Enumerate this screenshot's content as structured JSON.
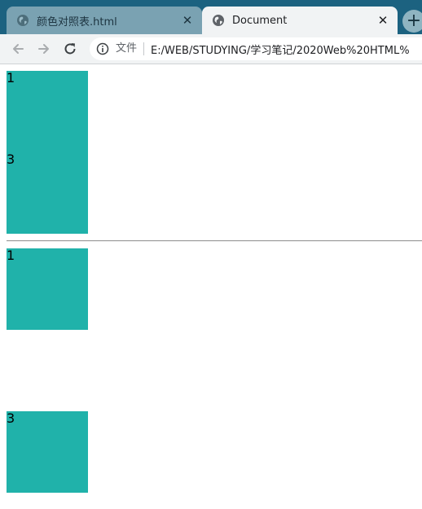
{
  "browser": {
    "tabs": [
      {
        "title": "颜色对照表.html",
        "active": false
      },
      {
        "title": "Document",
        "active": true
      }
    ],
    "new_tab_label": "+",
    "address_bar": {
      "security_label": "文件",
      "url": "E:/WEB/STUDYING/学习笔记/2020Web%20HTML%"
    }
  },
  "page": {
    "group_one": [
      {
        "label": "1"
      },
      {
        "label": "3"
      }
    ],
    "group_two": [
      {
        "label": "1"
      },
      {
        "label": "3"
      }
    ],
    "box_color": "#20b2aa"
  },
  "icons": {
    "tab_favicon": "globe-icon",
    "back": "arrow-left-icon",
    "forward": "arrow-right-icon",
    "reload": "reload-icon",
    "site_info": "info-icon",
    "close": "close-icon"
  },
  "colors": {
    "tabbar": "#1c6280",
    "toolbar": "#f1f3f4"
  }
}
